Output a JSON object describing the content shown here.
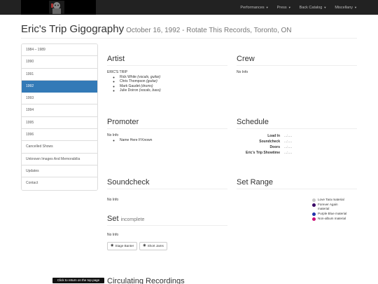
{
  "navbar": {
    "items": [
      {
        "label": "Performances"
      },
      {
        "label": "Press"
      },
      {
        "label": "Back Catalog"
      },
      {
        "label": "Miscellany"
      }
    ]
  },
  "title": {
    "main": "Eric's Trip Gigography",
    "sub": "October 16, 1992 - Rotate This Records, Toronto, ON"
  },
  "sidebar": {
    "items": [
      {
        "label": "1984 – 1989"
      },
      {
        "label": "1990"
      },
      {
        "label": "1991"
      },
      {
        "label": "1992"
      },
      {
        "label": "1993"
      },
      {
        "label": "1994"
      },
      {
        "label": "1995"
      },
      {
        "label": "1996"
      },
      {
        "label": "Cancelled Shows"
      },
      {
        "label": "Unknown Images And Memorabilia"
      },
      {
        "label": "Updates"
      },
      {
        "label": "Contact"
      }
    ],
    "active_index": 3
  },
  "artist": {
    "heading": "Artist",
    "band": "ERIC'S TRIP",
    "members": [
      {
        "name": "Rick White",
        "role": "(vocals, guitar)"
      },
      {
        "name": "Chris Thompson",
        "role": "(guitar)"
      },
      {
        "name": "Mark Gaudet",
        "role": "(drums)"
      },
      {
        "name": "Julie Doiron",
        "role": "(vocals, bass)"
      }
    ]
  },
  "crew": {
    "heading": "Crew",
    "text": "No Info"
  },
  "promoter": {
    "heading": "Promoter",
    "text": "No Info",
    "item": "Name Here If Known"
  },
  "schedule": {
    "heading": "Schedule",
    "rows": [
      {
        "label": "Load In",
        "value": "...:...."
      },
      {
        "label": "Soundcheck",
        "value": "...:...."
      },
      {
        "label": "Doors",
        "value": "...:...."
      },
      {
        "label": "Eric's Trip Showtime",
        "value": "...:...."
      }
    ]
  },
  "soundcheck": {
    "heading": "Soundcheck",
    "text": "No Info"
  },
  "set_range": {
    "heading": "Set Range",
    "legend": [
      {
        "label": "Love Tara material",
        "color": "#c8c8c8"
      },
      {
        "label": "Forever Again material",
        "color": "#3a0066"
      },
      {
        "label": "Purple Blue material",
        "color": "#2233aa"
      },
      {
        "label": "Non-album material",
        "color": "#cc1177"
      }
    ]
  },
  "set": {
    "heading": "Set",
    "note": "incomplete",
    "text": "No Info",
    "buttons": [
      {
        "label": "Stage Banter"
      },
      {
        "label": "Short Jams"
      }
    ]
  },
  "circulating": {
    "heading": "Circulating Recordings"
  },
  "top_link": {
    "label": "Click to return on the top page"
  }
}
